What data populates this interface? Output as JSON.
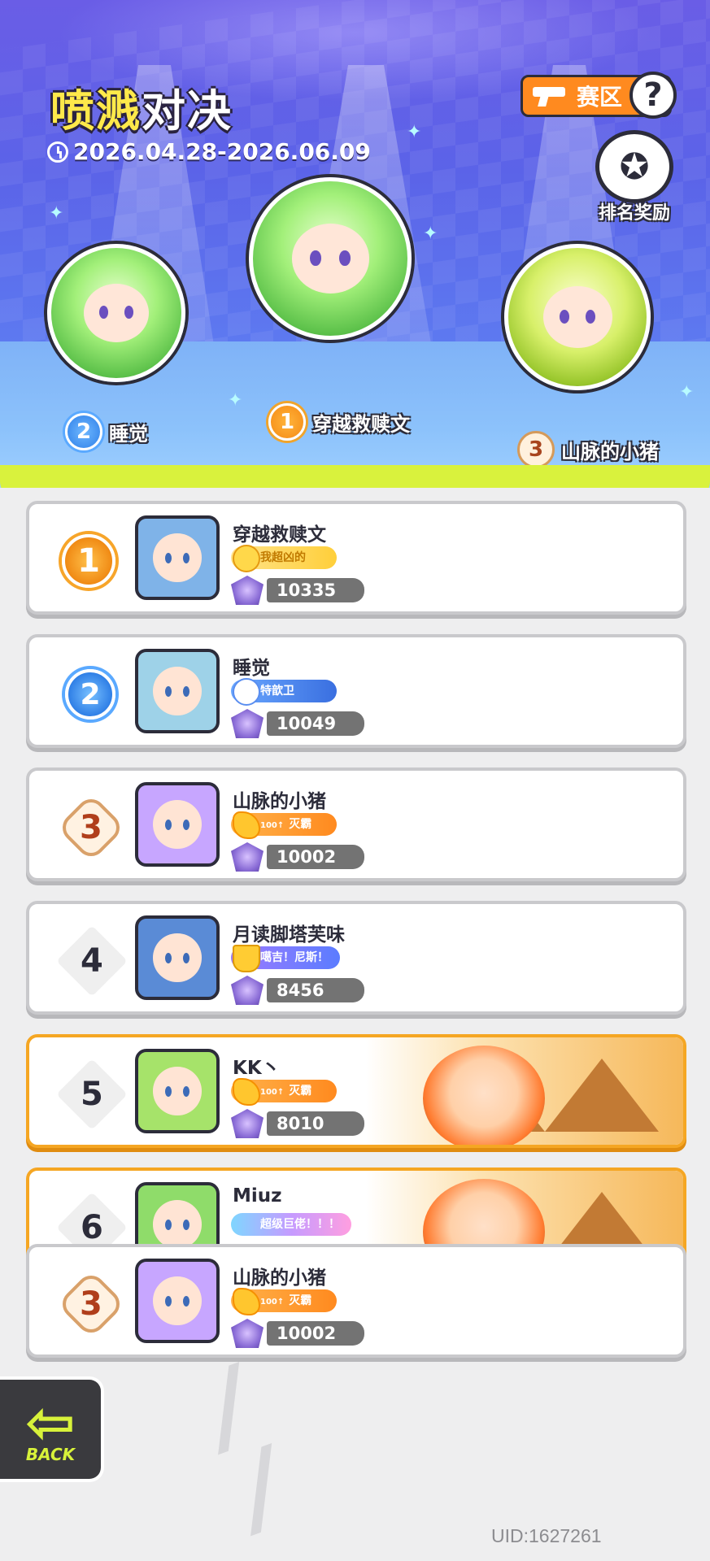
{
  "header": {
    "title_part1": "喷溅",
    "title_part2": "对决",
    "date_range": "2026.04.28-2026.06.09",
    "region_label": "赛区",
    "help_label": "?",
    "reward_label": "排名奖励"
  },
  "podium": [
    {
      "rank": "2",
      "name": "睡觉"
    },
    {
      "rank": "1",
      "name": "穿越救赎文"
    },
    {
      "rank": "3",
      "name": "山脉的小猪"
    }
  ],
  "leaderboard": [
    {
      "rank": "1",
      "name": "穿越救赎文",
      "title": "我超凶的",
      "score": "10335",
      "title_style": "yellow",
      "avatar_color": "#7fb3e8"
    },
    {
      "rank": "2",
      "name": "睡觉",
      "title": "特歆卫",
      "score": "10049",
      "title_style": "blue",
      "avatar_color": "#9ed2e8"
    },
    {
      "rank": "3",
      "name": "山脉的小猪",
      "title": "灭霸",
      "title_prefix": "100↑",
      "score": "10002",
      "title_style": "orange",
      "avatar_color": "#c7a6ff"
    },
    {
      "rank": "4",
      "name": "月读脚塔芙味",
      "title": "噶吉！尼斯！",
      "score": "8456",
      "title_style": "purple",
      "avatar_color": "#5a8bd6"
    },
    {
      "rank": "5",
      "name": "KK丶",
      "title": "灭霸",
      "title_prefix": "100↑",
      "score": "8010",
      "title_style": "orange",
      "avatar_color": "#a6e36a"
    },
    {
      "rank": "6",
      "name": "Miuz",
      "title": "超级巨佬！！！",
      "score": "",
      "title_style": "rainbow",
      "avatar_color": "#8fdc6a"
    }
  ],
  "my_rank": {
    "rank": "3",
    "name": "山脉的小猪",
    "title": "灭霸",
    "title_prefix": "100↑",
    "score": "10002",
    "title_style": "orange",
    "avatar_color": "#c7a6ff"
  },
  "footer": {
    "back_label": "BACK",
    "uid": "UID:1627261"
  },
  "colors": {
    "accent_yellow": "#d9f23d",
    "hero_top": "#6a5de6",
    "hero_bottom": "#6c95f4",
    "region_orange": "#ff8a1f",
    "score_bg": "#737373"
  }
}
